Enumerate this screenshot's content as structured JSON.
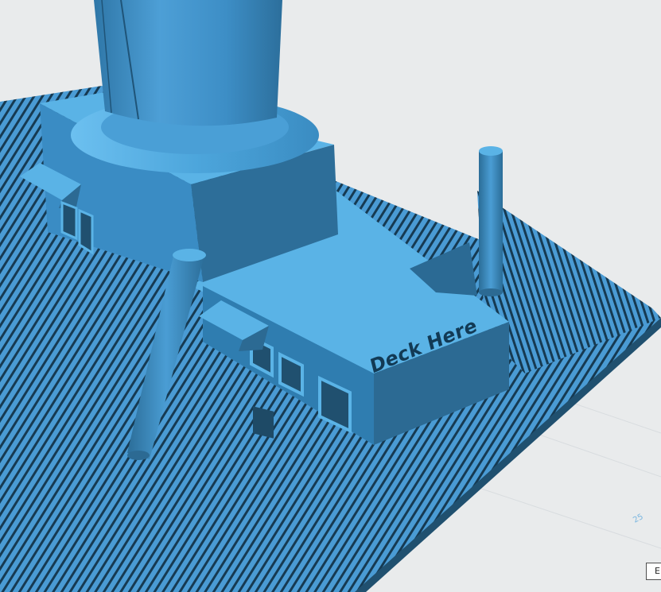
{
  "scene": {
    "model_text": "Deck Here",
    "grid_tick_label": "25",
    "colors": {
      "background": "#e9ebec",
      "model_top": "#5aaee2",
      "model_mid": "#3f8fc5",
      "model_side": "#2e6f98",
      "model_dark": "#20506f",
      "groove_dark": "#163a52"
    }
  },
  "view_corner": {
    "label": "E"
  }
}
